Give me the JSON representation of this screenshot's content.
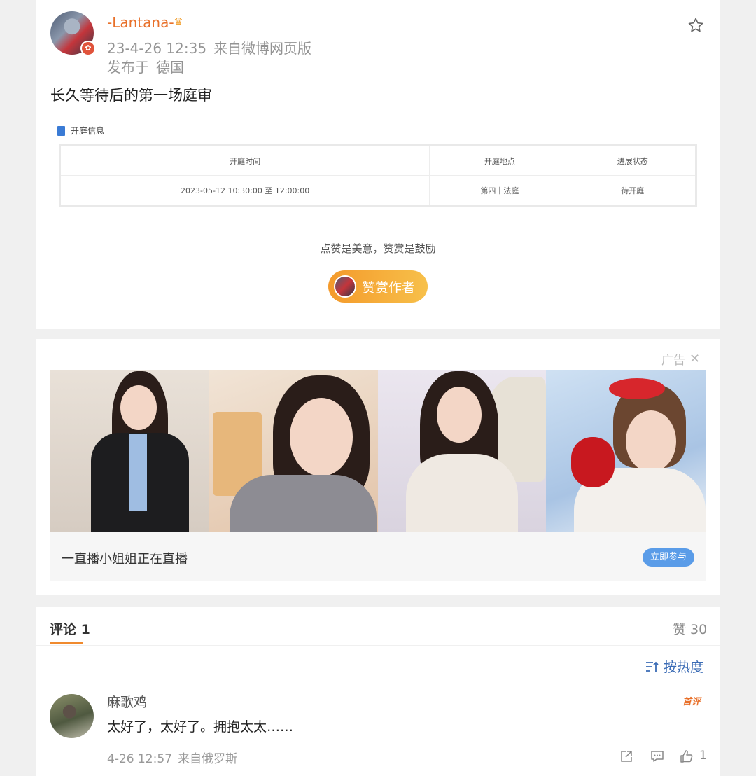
{
  "post": {
    "username": "-Lantana-",
    "crown_icon": "crown-icon",
    "time": "23-4-26 12:35",
    "source": "来自微博网页版",
    "location_label": "发布于",
    "location": "德国",
    "content": "长久等待后的第一场庭审",
    "court": {
      "section_title": "开庭信息",
      "headers": [
        "开庭时间",
        "开庭地点",
        "进展状态"
      ],
      "row": [
        "2023-05-12 10:30:00 至 12:00:00",
        "第四十法庭",
        "待开庭"
      ]
    },
    "reward_tagline": "点赞是美意，赞赏是鼓励",
    "reward_button": "赞赏作者"
  },
  "ad": {
    "tag": "广告",
    "close": "✕",
    "text": "一直播小姐姐正在直播",
    "button": "立即参与"
  },
  "comments": {
    "title": "评论 1",
    "likes": "赞 30",
    "sort": "按热度",
    "items": [
      {
        "name": "麻歌鸡",
        "text": "太好了，太好了。拥抱太太……",
        "badge": "首评",
        "time": "4-26 12:57",
        "source": "来自俄罗斯",
        "like_count": "1"
      }
    ]
  },
  "colors": {
    "accent_orange": "#e8702a",
    "link_blue": "#3a6bb5",
    "ad_button": "#5a9ce8"
  }
}
